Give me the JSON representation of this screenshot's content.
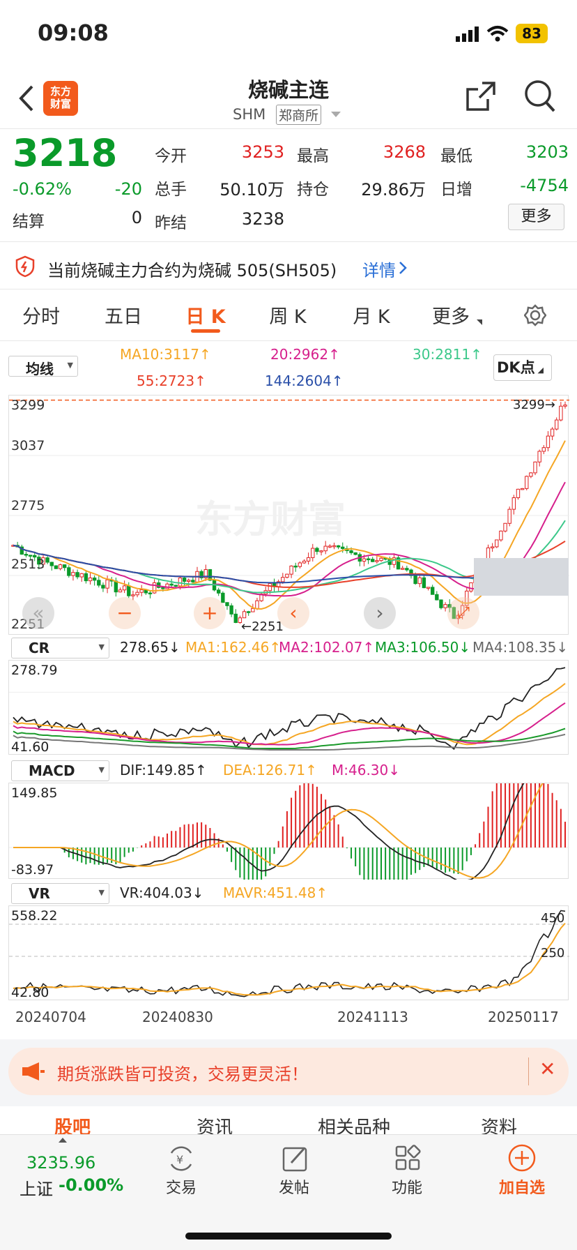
{
  "status": {
    "time": "09:08",
    "battery": "83"
  },
  "nav": {
    "logo": "东方财富",
    "title": "烧碱主连",
    "code": "SHM",
    "exchange": "郑商所"
  },
  "quote": {
    "price": "3218",
    "pct": "-0.62%",
    "chg": "-20",
    "settle_label": "结算",
    "settle": "0",
    "open_label": "今开",
    "open": "3253",
    "high_label": "最高",
    "high": "3268",
    "low_label": "最低",
    "low": "3203",
    "vol_label": "总手",
    "vol": "50.10万",
    "oi_label": "持仓",
    "oi": "29.86万",
    "inc_label": "日增",
    "inc": "-4754",
    "prev_label": "昨结",
    "prev": "3238",
    "more": "更多"
  },
  "notice": {
    "text": "当前烧碱主力合约为烧碱 505(SH505)",
    "link": "详情"
  },
  "tabs": [
    "分时",
    "五日",
    "日 K",
    "周 K",
    "月 K",
    "更多"
  ],
  "active_tab": 2,
  "ma": {
    "select": "均线",
    "ma10": "MA10:3117↑",
    "ma20": "20:2962↑",
    "ma30": "30:2811↑",
    "ma55": "55:2723↑",
    "ma144": "144:2604↑",
    "dk": "DK点"
  },
  "colors": {
    "ma10": "#f5a623",
    "ma20": "#d61f8c",
    "ma30": "#3cc88a",
    "ma55": "#e8402a",
    "ma144": "#2a4fa8",
    "up": "#e02020",
    "down": "#0a9a2a"
  },
  "kline": {
    "y_top": "3299",
    "y2": "3037",
    "y3": "2775",
    "y4": "2513",
    "y_bot": "2251",
    "low_mark": "←2251",
    "high_mark": "3299→",
    "watermark": "东方财富"
  },
  "cr": {
    "select": "CR",
    "val": "278.65↓",
    "ma1": "MA1:162.46↑",
    "ma2": "MA2:102.07↑",
    "ma3": "MA3:106.50↓",
    "ma4": "MA4:108.35↓",
    "top": "278.79",
    "bot": "41.60"
  },
  "macd": {
    "select": "MACD",
    "dif": "DIF:149.85↑",
    "dea": "DEA:126.71↑",
    "m": "M:46.30↓",
    "top": "149.85",
    "bot": "-83.97"
  },
  "vr": {
    "select": "VR",
    "vr": "VR:404.03↓",
    "mavr": "MAVR:451.48↑",
    "top": "558.22",
    "bot": "42.80",
    "r1": "450",
    "r2": "250"
  },
  "dates": [
    "20240704",
    "20240830",
    "20241113",
    "20250117"
  ],
  "banner": {
    "text": "期货涨跌皆可投资，交易更灵活！"
  },
  "subtabs": [
    "股吧",
    "资讯",
    "相关品种",
    "资料"
  ],
  "bottom": {
    "index_val": "3235.96",
    "index_name": "上证",
    "index_pct": "-0.00%",
    "trade": "交易",
    "post": "发帖",
    "func": "功能",
    "add": "加自选"
  }
}
